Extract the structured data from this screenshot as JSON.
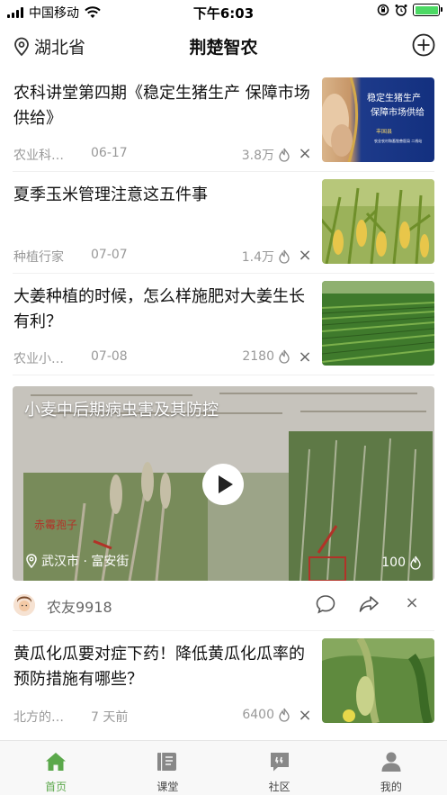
{
  "status_bar": {
    "carrier": "中国移动",
    "time": "下午6:03"
  },
  "nav": {
    "location": "湖北省",
    "title": "荆楚智农",
    "add_icon": "plus-circle-icon"
  },
  "articles": [
    {
      "title": "农科讲堂第四期《稳定生猪生产 保障市场供给》",
      "source": "农业科…",
      "date": "06-17",
      "views": "3.8万",
      "thumb": {
        "line1": "稳定生猪生产",
        "line2": "保障市场供给",
        "line3": "丰国县",
        "line4": "农业农村和畜牧兽医局 二线站"
      }
    },
    {
      "title": "夏季玉米管理注意这五件事",
      "source": "种植行家",
      "date": "07-07",
      "views": "1.4万"
    },
    {
      "title": "大姜种植的时候，怎么样施肥对大姜生长有利？",
      "source": "农业小…",
      "date": "07-08",
      "views": "2180"
    }
  ],
  "video": {
    "title": "小麦中后期病虫害及其防控",
    "location": "武汉市 · 富安街",
    "views": "100",
    "inset_text": "赤霉孢子",
    "user": "农友9918"
  },
  "article_last": {
    "title": "黄瓜化瓜要对症下药！降低黄瓜化瓜率的预防措施有哪些？",
    "source": "北方的…",
    "date": "7 天前",
    "views": "6400"
  },
  "tabs": [
    {
      "label": "首页",
      "icon": "home-icon",
      "active": true
    },
    {
      "label": "课堂",
      "icon": "book-icon",
      "active": false
    },
    {
      "label": "社区",
      "icon": "chat-bubble-icon",
      "active": false
    },
    {
      "label": "我的",
      "icon": "person-icon",
      "active": false
    }
  ],
  "colors": {
    "accent": "#5ba84b",
    "inactive": "#888888"
  }
}
